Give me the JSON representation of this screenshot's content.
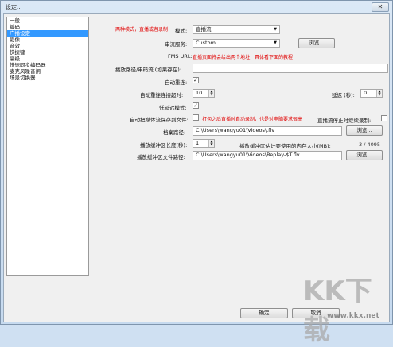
{
  "window": {
    "title": "设定...",
    "close_glyph": "✕"
  },
  "sidebar": {
    "items": [
      {
        "label": "一般",
        "selected": false
      },
      {
        "label": "编码",
        "selected": false
      },
      {
        "label": "广播设定",
        "selected": true
      },
      {
        "label": "影像",
        "selected": false
      },
      {
        "label": "音效",
        "selected": false
      },
      {
        "label": "快捷键",
        "selected": false
      },
      {
        "label": "高级",
        "selected": false
      },
      {
        "label": "快速同步编码器",
        "selected": false
      },
      {
        "label": "麦克风噪音闸",
        "selected": false
      },
      {
        "label": "场景切换器",
        "selected": false
      }
    ]
  },
  "form": {
    "mode_note": "两种模式，直播或者录制",
    "mode_label": "模式:",
    "mode_value": "直播流",
    "service_label": "串流服务:",
    "service_value": "Custom",
    "browse_label": "浏览...",
    "fms_label": "FMS URL:",
    "fms_note": "直播页面将会给出两个地址，具体看下面的教程",
    "stream_path_label": "播放路径/串码流 (如果存在):",
    "auto_reconnect_label": "自动重连:",
    "auto_reconnect_checked": true,
    "auto_reconnect_timeout_label": "自动重连连接超时:",
    "auto_reconnect_timeout_value": "10",
    "delay_label": "延迟 (秒):",
    "delay_value": "0",
    "low_latency_label": "低延迟模式:",
    "low_latency_checked": true,
    "auto_save_label": "自动把媒体流保存到文件:",
    "auto_save_checked": false,
    "auto_save_note": "打勾之后直播时自动录制，也是对电脑要求很高",
    "stop_replay_label": "直播流停止时继续录制:",
    "stop_replay_checked": false,
    "file_path_label": "档案路径:",
    "file_path_value": "C:\\Users\\wangyu01\\Videos\\.flv",
    "replay_length_label": "播放缓冲区长度(秒):",
    "replay_length_value": "1",
    "replay_mem_label": "播放缓冲区估计要使用的内存大小(MB):",
    "replay_mem_value": "3 / 4095",
    "replay_path_label": "播放缓冲区文件路径:",
    "replay_path_value": "C:\\Users\\wangyu01\\Videos\\Replay-$T.flv",
    "check_glyph": "✓",
    "combo_arrow": "▼",
    "spin_up": "▲",
    "spin_down": "▼"
  },
  "footer": {
    "ok_label": "确定",
    "cancel_label": "取消"
  },
  "watermark": {
    "logo": "KK下载",
    "url": "www.kkx.net"
  }
}
